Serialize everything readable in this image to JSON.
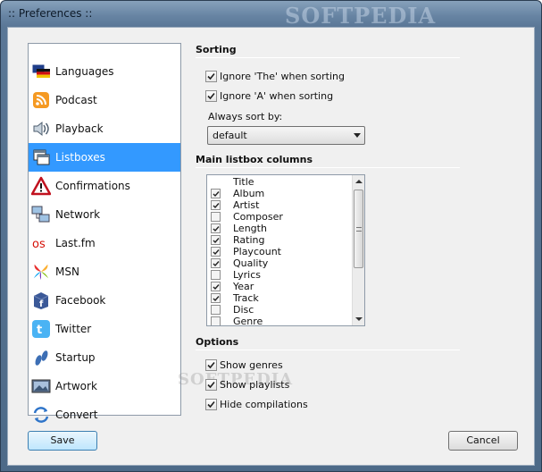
{
  "window": {
    "title": ":: Preferences ::",
    "watermark": "SOFTPEDIA"
  },
  "sidebar": {
    "items": [
      {
        "label": "Languages",
        "icon": "flags-icon"
      },
      {
        "label": "Podcast",
        "icon": "rss-icon"
      },
      {
        "label": "Playback",
        "icon": "speaker-icon"
      },
      {
        "label": "Listboxes",
        "icon": "listbox-icon",
        "selected": true
      },
      {
        "label": "Confirmations",
        "icon": "warning-icon"
      },
      {
        "label": "Network",
        "icon": "network-icon"
      },
      {
        "label": "Last.fm",
        "icon": "lastfm-icon"
      },
      {
        "label": "MSN",
        "icon": "msn-icon"
      },
      {
        "label": "Facebook",
        "icon": "facebook-icon"
      },
      {
        "label": "Twitter",
        "icon": "twitter-icon"
      },
      {
        "label": "Startup",
        "icon": "startup-icon"
      },
      {
        "label": "Artwork",
        "icon": "artwork-icon"
      },
      {
        "label": "Convert",
        "icon": "convert-icon"
      }
    ]
  },
  "sorting": {
    "title": "Sorting",
    "ignore_the": {
      "label": "Ignore 'The' when sorting",
      "checked": true
    },
    "ignore_a": {
      "label": "Ignore 'A' when sorting",
      "checked": true
    },
    "always_sort_label": "Always sort by:",
    "always_sort_value": "default"
  },
  "columns": {
    "title": "Main listbox columns",
    "items": [
      {
        "label": "Title",
        "checkbox": false
      },
      {
        "label": "Album",
        "checked": true
      },
      {
        "label": "Artist",
        "checked": true
      },
      {
        "label": "Composer",
        "checked": false
      },
      {
        "label": "Length",
        "checked": true
      },
      {
        "label": "Rating",
        "checked": true
      },
      {
        "label": "Playcount",
        "checked": true
      },
      {
        "label": "Quality",
        "checked": true
      },
      {
        "label": "Lyrics",
        "checked": false
      },
      {
        "label": "Year",
        "checked": true
      },
      {
        "label": "Track",
        "checked": true
      },
      {
        "label": "Disc",
        "checked": false
      },
      {
        "label": "Genre",
        "checked": false
      }
    ]
  },
  "options": {
    "title": "Options",
    "show_genres": {
      "label": "Show genres",
      "checked": true
    },
    "show_playlists": {
      "label": "Show playlists",
      "checked": true
    },
    "hide_compilations": {
      "label": "Hide compilations",
      "checked": true
    }
  },
  "buttons": {
    "save": "Save",
    "cancel": "Cancel"
  },
  "colors": {
    "selection": "#3399ff",
    "accent_border": "#3c7fb1"
  }
}
